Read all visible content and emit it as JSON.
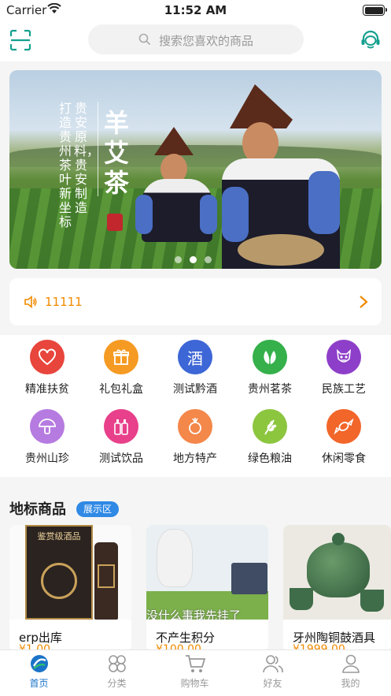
{
  "status_bar": {
    "carrier": "Carrier",
    "time": "11:52 AM"
  },
  "search": {
    "placeholder": "搜索您喜欢的商品"
  },
  "banner": {
    "column_1": "打造贵州茶叶新坐标",
    "column_2": "贵安原料，贵安制造",
    "brand": "羊艾茶",
    "seal": "中国贵安",
    "slide_count": 3,
    "active_slide": 1
  },
  "notice": {
    "text": "11111"
  },
  "categories": [
    {
      "label": "精准扶贫",
      "icon": "heart-icon",
      "color": "#e8453c"
    },
    {
      "label": "礼包礼盒",
      "icon": "gift-icon",
      "color": "#f59a23"
    },
    {
      "label": "测试黔酒",
      "icon": "liquor-icon",
      "color": "#3d66d6"
    },
    {
      "label": "贵州茗茶",
      "icon": "tea-leaf-icon",
      "color": "#35b04a"
    },
    {
      "label": "民族工艺",
      "icon": "ethnic-mask-icon",
      "color": "#8e3fc9"
    },
    {
      "label": "贵州山珍",
      "icon": "mushroom-icon",
      "color": "#b67be0"
    },
    {
      "label": "测试饮品",
      "icon": "drinks-icon",
      "color": "#e8408a"
    },
    {
      "label": "地方特产",
      "icon": "radish-icon",
      "color": "#f4874a"
    },
    {
      "label": "绿色粮油",
      "icon": "grain-icon",
      "color": "#8cc63f"
    },
    {
      "label": "休闲零食",
      "icon": "candy-icon",
      "color": "#f2662a"
    }
  ],
  "section": {
    "title": "地标商品",
    "badge": "展示区"
  },
  "goods": [
    {
      "name": "erp出库",
      "price": "¥1.00",
      "pic_text": "鉴赏级酒品"
    },
    {
      "name": "不产生积分",
      "price": "¥100.00",
      "pic_text": "没什么事我先挂了"
    },
    {
      "name": "牙州陶铜鼓酒具",
      "price": "¥1999.00"
    }
  ],
  "tabs": [
    {
      "label": "首页",
      "icon": "home-logo-icon",
      "active": true
    },
    {
      "label": "分类",
      "icon": "category-icon",
      "active": false
    },
    {
      "label": "购物车",
      "icon": "cart-icon",
      "active": false
    },
    {
      "label": "好友",
      "icon": "friends-icon",
      "active": false
    },
    {
      "label": "我的",
      "icon": "profile-icon",
      "active": false
    }
  ],
  "colors": {
    "accent": "#f08a00",
    "brand": "#1a73c8",
    "badge": "#2f89e5"
  }
}
